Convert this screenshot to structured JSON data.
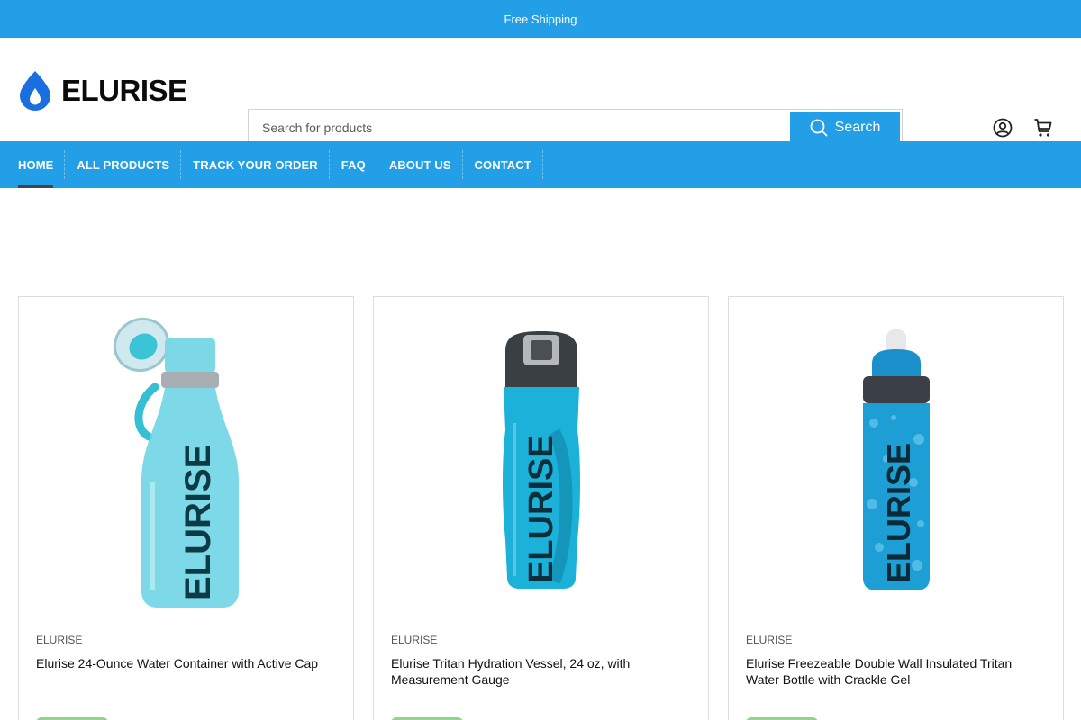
{
  "announcement": {
    "text": "Free Shipping"
  },
  "brand": {
    "logo_text": "ELURISE",
    "accent": "#229fe6",
    "logo_drop_color": "#1a6fe0"
  },
  "search": {
    "placeholder": "Search for products",
    "button_label": "Search",
    "icon": "search-icon"
  },
  "header_icons": [
    {
      "name": "account-icon"
    },
    {
      "name": "cart-icon"
    }
  ],
  "nav": {
    "items": [
      {
        "label": "HOME",
        "active": true
      },
      {
        "label": "ALL PRODUCTS",
        "active": false
      },
      {
        "label": "TRACK YOUR ORDER",
        "active": false
      },
      {
        "label": "FAQ",
        "active": false
      },
      {
        "label": "ABOUT US",
        "active": false
      },
      {
        "label": "CONTACT",
        "active": false
      }
    ]
  },
  "products": [
    {
      "brand": "ELURISE",
      "title": "Elurise 24-Ounce Water Container with Active Cap",
      "image": "bottle-flip-cap-image",
      "color": "#5fd0e2"
    },
    {
      "brand": "ELURISE",
      "title": "Elurise Tritan Hydration Vessel, 24 oz, with Measurement Gauge",
      "image": "bottle-tritan-image",
      "color": "#1fb0d6"
    },
    {
      "brand": "ELURISE",
      "title": "Elurise Freezeable Double Wall Insulated Tritan Water Bottle with Crackle Gel",
      "image": "bottle-crackle-image",
      "color": "#1e9fd4"
    }
  ]
}
